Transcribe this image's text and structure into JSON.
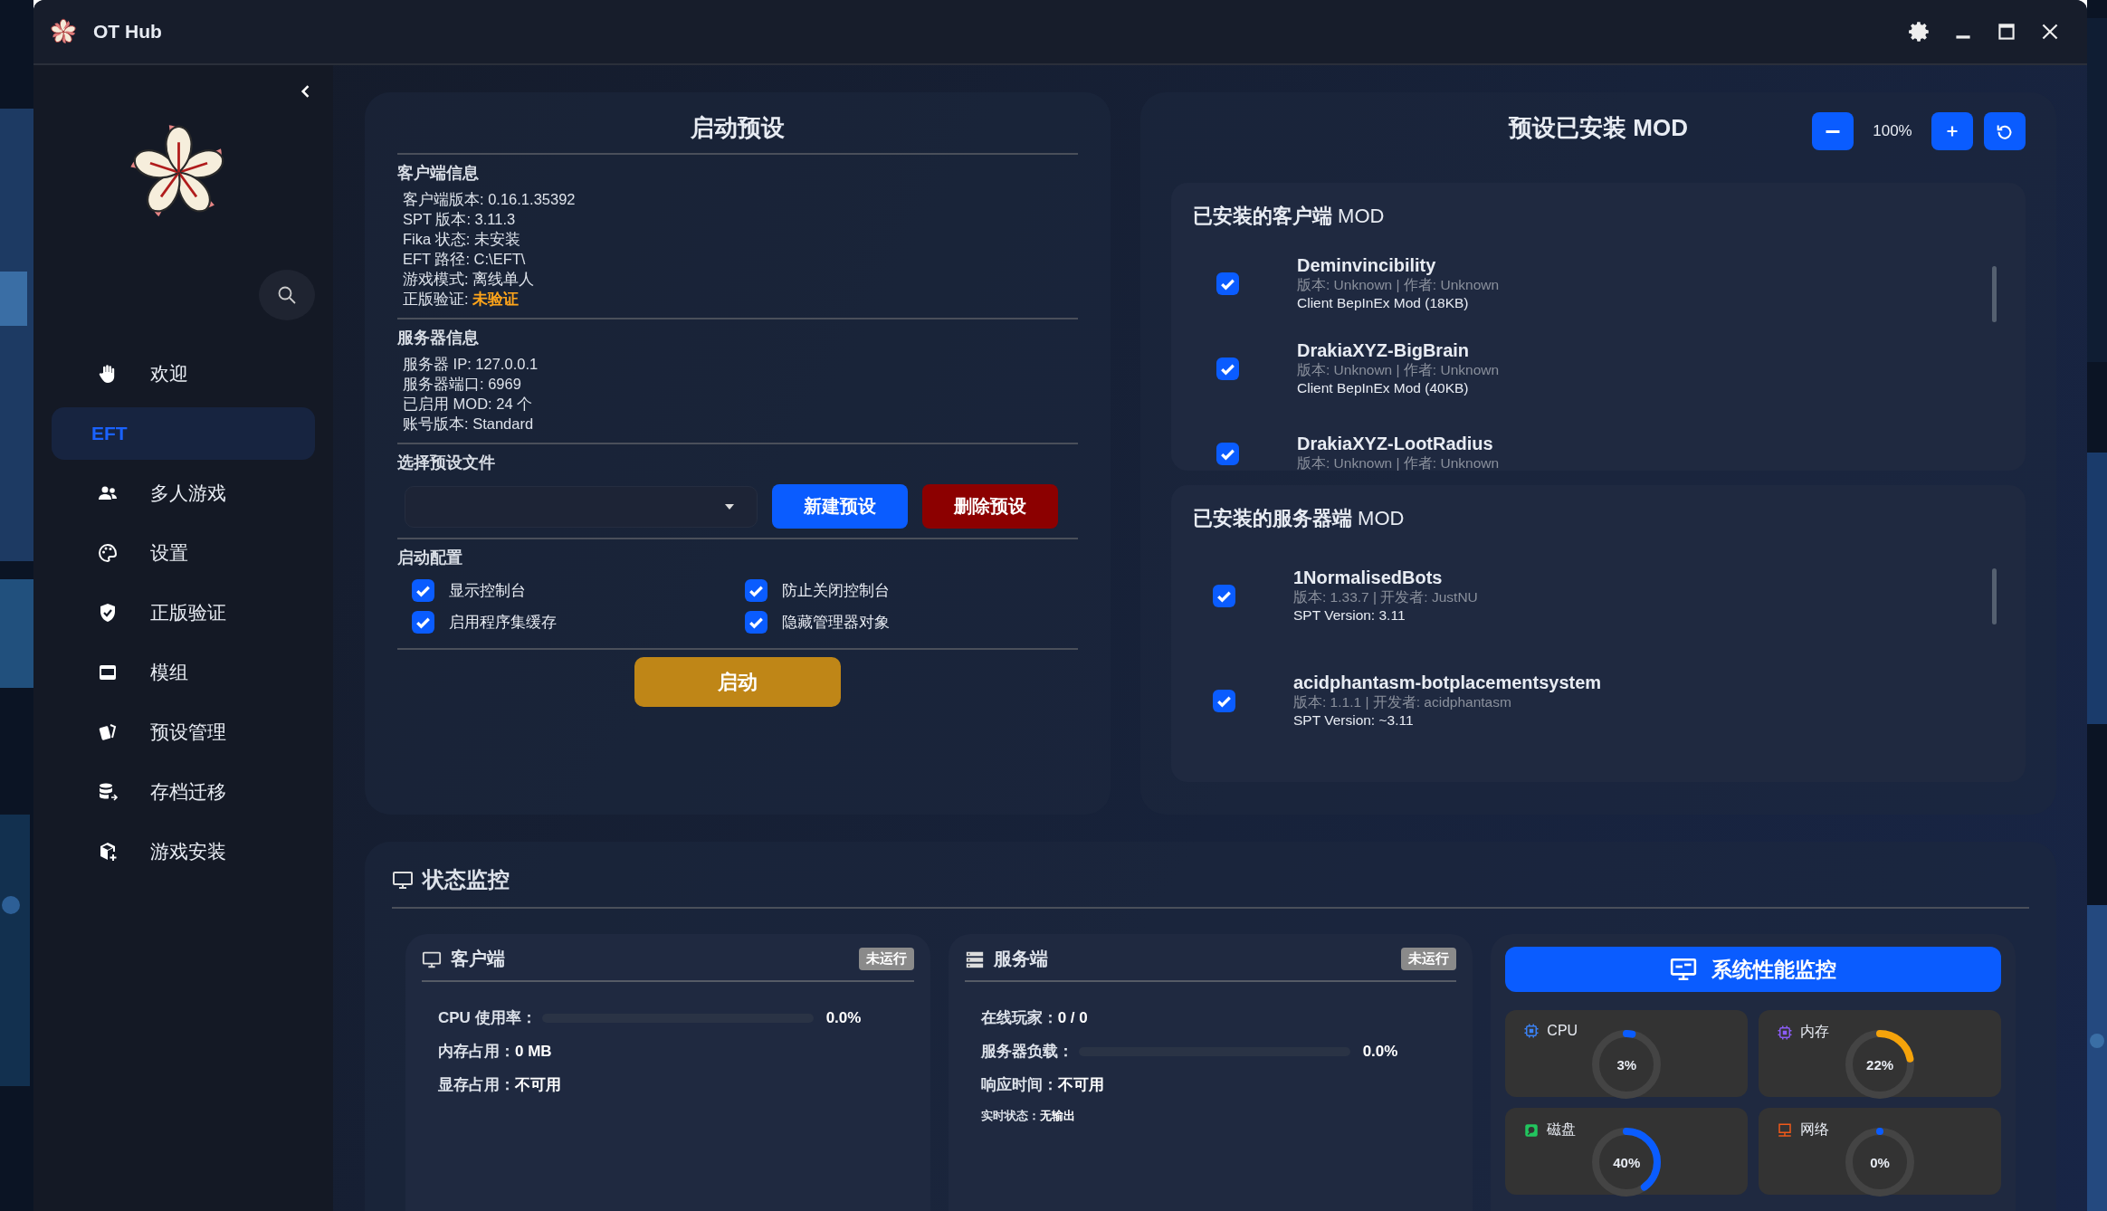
{
  "window": {
    "title": "OT Hub"
  },
  "sidebar": {
    "items": [
      {
        "label": "欢迎",
        "selected": false
      },
      {
        "label": "EFT",
        "selected": true
      },
      {
        "label": "多人游戏",
        "selected": false
      },
      {
        "label": "设置",
        "selected": false
      },
      {
        "label": "正版验证",
        "selected": false
      },
      {
        "label": "模组",
        "selected": false
      },
      {
        "label": "预设管理",
        "selected": false
      },
      {
        "label": "存档迁移",
        "selected": false
      },
      {
        "label": "游戏安装",
        "selected": false
      }
    ]
  },
  "launch": {
    "title": "启动预设",
    "info_sections": [
      {
        "heading": "客户端信息",
        "lines": [
          "客户端版本: 0.16.1.35392",
          "SPT 版本: 3.11.3",
          "Fika 状态: 未安装",
          "EFT 路径: C:\\EFT\\",
          "游戏模式: 离线单人",
          "正版验证: **未验证**"
        ]
      },
      {
        "heading": "服务器信息",
        "lines": [
          "服务器 IP: 127.0.0.1",
          "服务器端口: 6969",
          "已启用 MOD: 24 个",
          "账号版本: Standard"
        ]
      }
    ],
    "preset": {
      "heading": "选择预设文件",
      "buttons": [
        {
          "label": "新建预设",
          "kind": "primary"
        },
        {
          "label": "删除预设",
          "kind": "danger"
        }
      ]
    },
    "config": {
      "heading": "启动配置",
      "options": [
        {
          "label": "显示控制台",
          "checked": true
        },
        {
          "label": "防止关闭控制台",
          "checked": true
        },
        {
          "label": "启用程序集缓存",
          "checked": true
        },
        {
          "label": "隐藏管理器对象",
          "checked": true
        }
      ]
    },
    "launch_button": "启动"
  },
  "mods": {
    "title": "预设已安装 MOD",
    "zoom": "100%",
    "sections": [
      {
        "title": "**已安装的客户端** MOD",
        "items": [
          {
            "name": "Deminvincibility",
            "meta": "版本: Unknown | 作者: Unknown",
            "desc": "Client BepInEx Mod (18KB)",
            "checked": true
          },
          {
            "name": "DrakiaXYZ-BigBrain",
            "meta": "版本: Unknown | 作者: Unknown",
            "desc": "Client BepInEx Mod (40KB)",
            "checked": true
          },
          {
            "name": "DrakiaXYZ-LootRadius",
            "meta": "版本: Unknown | 作者: Unknown",
            "checked": true
          }
        ]
      },
      {
        "title": "**已安装的服务器端** MOD",
        "items": [
          {
            "name": "1NormalisedBots",
            "meta": "版本: 1.33.7 | 开发者: JustNU",
            "desc": "SPT Version: 3.11",
            "checked": true
          },
          {
            "name": "acidphantasm-botplacementsystem",
            "meta": "版本: 1.1.1 | 开发者: acidphantasm",
            "desc": "SPT Version: ~3.11",
            "checked": true
          }
        ]
      }
    ]
  },
  "status": {
    "title": "状态监控",
    "panels": [
      {
        "title": "客户端",
        "badge": "未运行",
        "rows": [
          {
            "kind": "bar",
            "label": "CPU 使用率：",
            "level": 0,
            "value": "0.0%"
          },
          {
            "kind": "text",
            "label": "内存占用：",
            "value": "0 MB"
          },
          {
            "kind": "text",
            "label": "显存占用：",
            "value": "不可用"
          }
        ]
      },
      {
        "title": "服务端",
        "badge": "未运行",
        "rows": [
          {
            "kind": "text",
            "label": "在线玩家：",
            "value": "0 / 0"
          },
          {
            "kind": "bar",
            "label": "服务器负载：",
            "level": 0,
            "value": "0.0%"
          },
          {
            "kind": "text",
            "label": "响应时间：",
            "value": "不可用"
          },
          {
            "kind": "small",
            "label": "实时状态：",
            "value": "无输出"
          }
        ]
      }
    ],
    "performance": {
      "title": "系统性能监控",
      "gauges": [
        {
          "label": "CPU",
          "level": 0.03,
          "reading": "3%",
          "color": "#0a5cff"
        },
        {
          "label": "内存",
          "level": 0.22,
          "reading": "22%",
          "color": "#f5a30a"
        },
        {
          "label": "磁盘",
          "level": 0.4,
          "reading": "40%",
          "color": "#0a5cff"
        },
        {
          "label": "网络",
          "level": 0,
          "reading": "0%",
          "color": "#0a5cff"
        }
      ]
    }
  }
}
